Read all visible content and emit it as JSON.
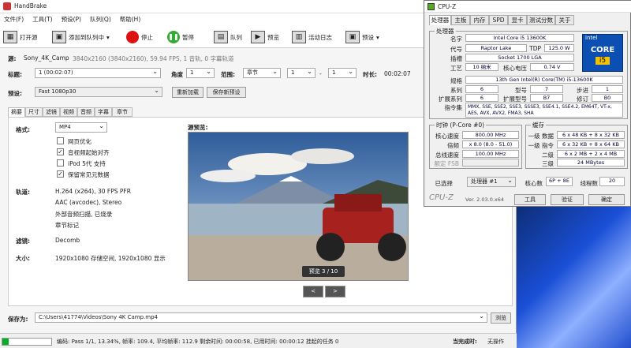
{
  "handbrake": {
    "title": "HandBrake",
    "menu": [
      "文件(F)",
      "工具(T)",
      "预设(P)",
      "队列(Q)",
      "帮助(H)"
    ],
    "toolbar": {
      "open": "打开源",
      "add_queue": "添加到队列中",
      "stop": "停止",
      "pause": "暂停",
      "queue": "队列",
      "preview": "预览",
      "activity": "活动日志",
      "presets": "预设"
    },
    "source": {
      "label": "源:",
      "name": "Sony_4K_Camp",
      "info": "3840x2160 (3840x2160), 59.94 FPS, 1 音轨, 0 字幕轨道"
    },
    "title_row": {
      "label": "标题:",
      "title_value": "1 (00:02:07)",
      "angle_label": "角度",
      "angle_value": "1",
      "range_label": "范围:",
      "range_type": "章节",
      "range_from": "1",
      "dash": "-",
      "range_to": "1",
      "duration_label": "时长:",
      "duration_value": "00:02:07"
    },
    "preset_row": {
      "label": "预设:",
      "value": "Fast 1080p30",
      "reload": "重新加载",
      "save_new": "保存新预设"
    },
    "tabs": [
      "摘要",
      "尺寸",
      "滤镜",
      "视频",
      "音频",
      "字幕",
      "章节"
    ],
    "summary": {
      "format_label": "格式:",
      "format_value": "MP4",
      "checks": [
        {
          "label": "网页优化",
          "checked": false
        },
        {
          "label": "音视频起始对齐",
          "checked": true
        },
        {
          "label": "iPod 5代 支持",
          "checked": false
        },
        {
          "label": "保留常见元数据",
          "checked": true
        }
      ],
      "tracks_label": "轨道:",
      "tracks": [
        "H.264 (x264), 30 FPS PFR",
        "AAC (avcodec), Stereo",
        "外部音频扫描, 已烧录",
        "章节标记"
      ],
      "filters_label": "滤镜:",
      "filters_value": "Decomb",
      "size_label": "大小:",
      "size_value": "1920x1080 存储空间, 1920x1080 显示",
      "preview_label": "源预览:",
      "preview_badge": "预览 3 / 10",
      "prev": "<",
      "next": ">"
    },
    "save": {
      "label": "保存为:",
      "path": "C:\\Users\\41774\\Videos\\Sony 4K Camp.mp4",
      "browse": "浏览"
    },
    "status": {
      "text": "编码: Pass 1/1, 13.34%, 帧率: 109.4, 平均帧率: 112.9 剩余时间: 00:00:58, 已用时间: 00:00:12   挂起的任务 0",
      "done_label": "当完成时:",
      "done_value": "无操作",
      "progress": 0.1334
    }
  },
  "cpuz": {
    "title": "CPU-Z",
    "tabs": [
      "处理器",
      "主板",
      "内存",
      "SPD",
      "显卡",
      "测试分数",
      "关于"
    ],
    "proc_group": "处理器",
    "name_label": "名字",
    "name": "Intel Core i5 13600K",
    "code_label": "代号",
    "code": "Raptor Lake",
    "tdp_label": "TDP",
    "tdp": "125.0 W",
    "socket_label": "插槽",
    "socket": "Socket 1700 LGA",
    "tech_label": "工艺",
    "tech": "10 纳米",
    "vcore_label": "核心电压",
    "vcore": "0.74 V",
    "spec_label": "规格",
    "spec": "13th Gen Intel(R) Core(TM) i5-13600K",
    "family_label": "系列",
    "family": "6",
    "model_label": "型号",
    "model": "7",
    "stepping_label": "步进",
    "stepping": "1",
    "extfam_label": "扩展系列",
    "extfam": "6",
    "extmod_label": "扩展型号",
    "extmod": "B7",
    "rev_label": "修订",
    "rev": "B0",
    "inst_label": "指令集",
    "inst": "MMX, SSE, SSE2, SSE3, SSSE3, SSE4.1, SSE4.2, EM64T, VT-x, AES, AVX, AVX2, FMA3, SHA",
    "clock_group": "时钟 (P-Core #0)",
    "core_speed_label": "核心速度",
    "core_speed": "800.00 MHz",
    "mult_label": "倍频",
    "mult": "x 8.0 (8.0 - 51.0)",
    "bus_label": "总线速度",
    "bus": "100.00 MHz",
    "fsb_label": "额定 FSB",
    "fsb": "",
    "cache_group": "缓存",
    "l1d_label": "一级 数据",
    "l1d": "6 x 48 KB + 8 x 32 KB",
    "l1i_label": "一级 指令",
    "l1i": "6 x 32 KB + 8 x 64 KB",
    "l2_label": "二级",
    "l2": "6 x 2 MB + 2 x 4 MB",
    "l3_label": "三级",
    "l3": "24 MBytes",
    "selected_label": "已选择",
    "selected": "处理器 #1",
    "cores_label": "核心数",
    "cores": "6P + 8E",
    "threads_label": "线程数",
    "threads": "20",
    "logo_text": "CPU-Z",
    "version": "Ver. 2.03.0.x64",
    "tools": "工具",
    "validate": "验证",
    "ok": "确定",
    "badge_brand": "intel",
    "badge_core": "CORE",
    "badge_gen": "i5"
  }
}
